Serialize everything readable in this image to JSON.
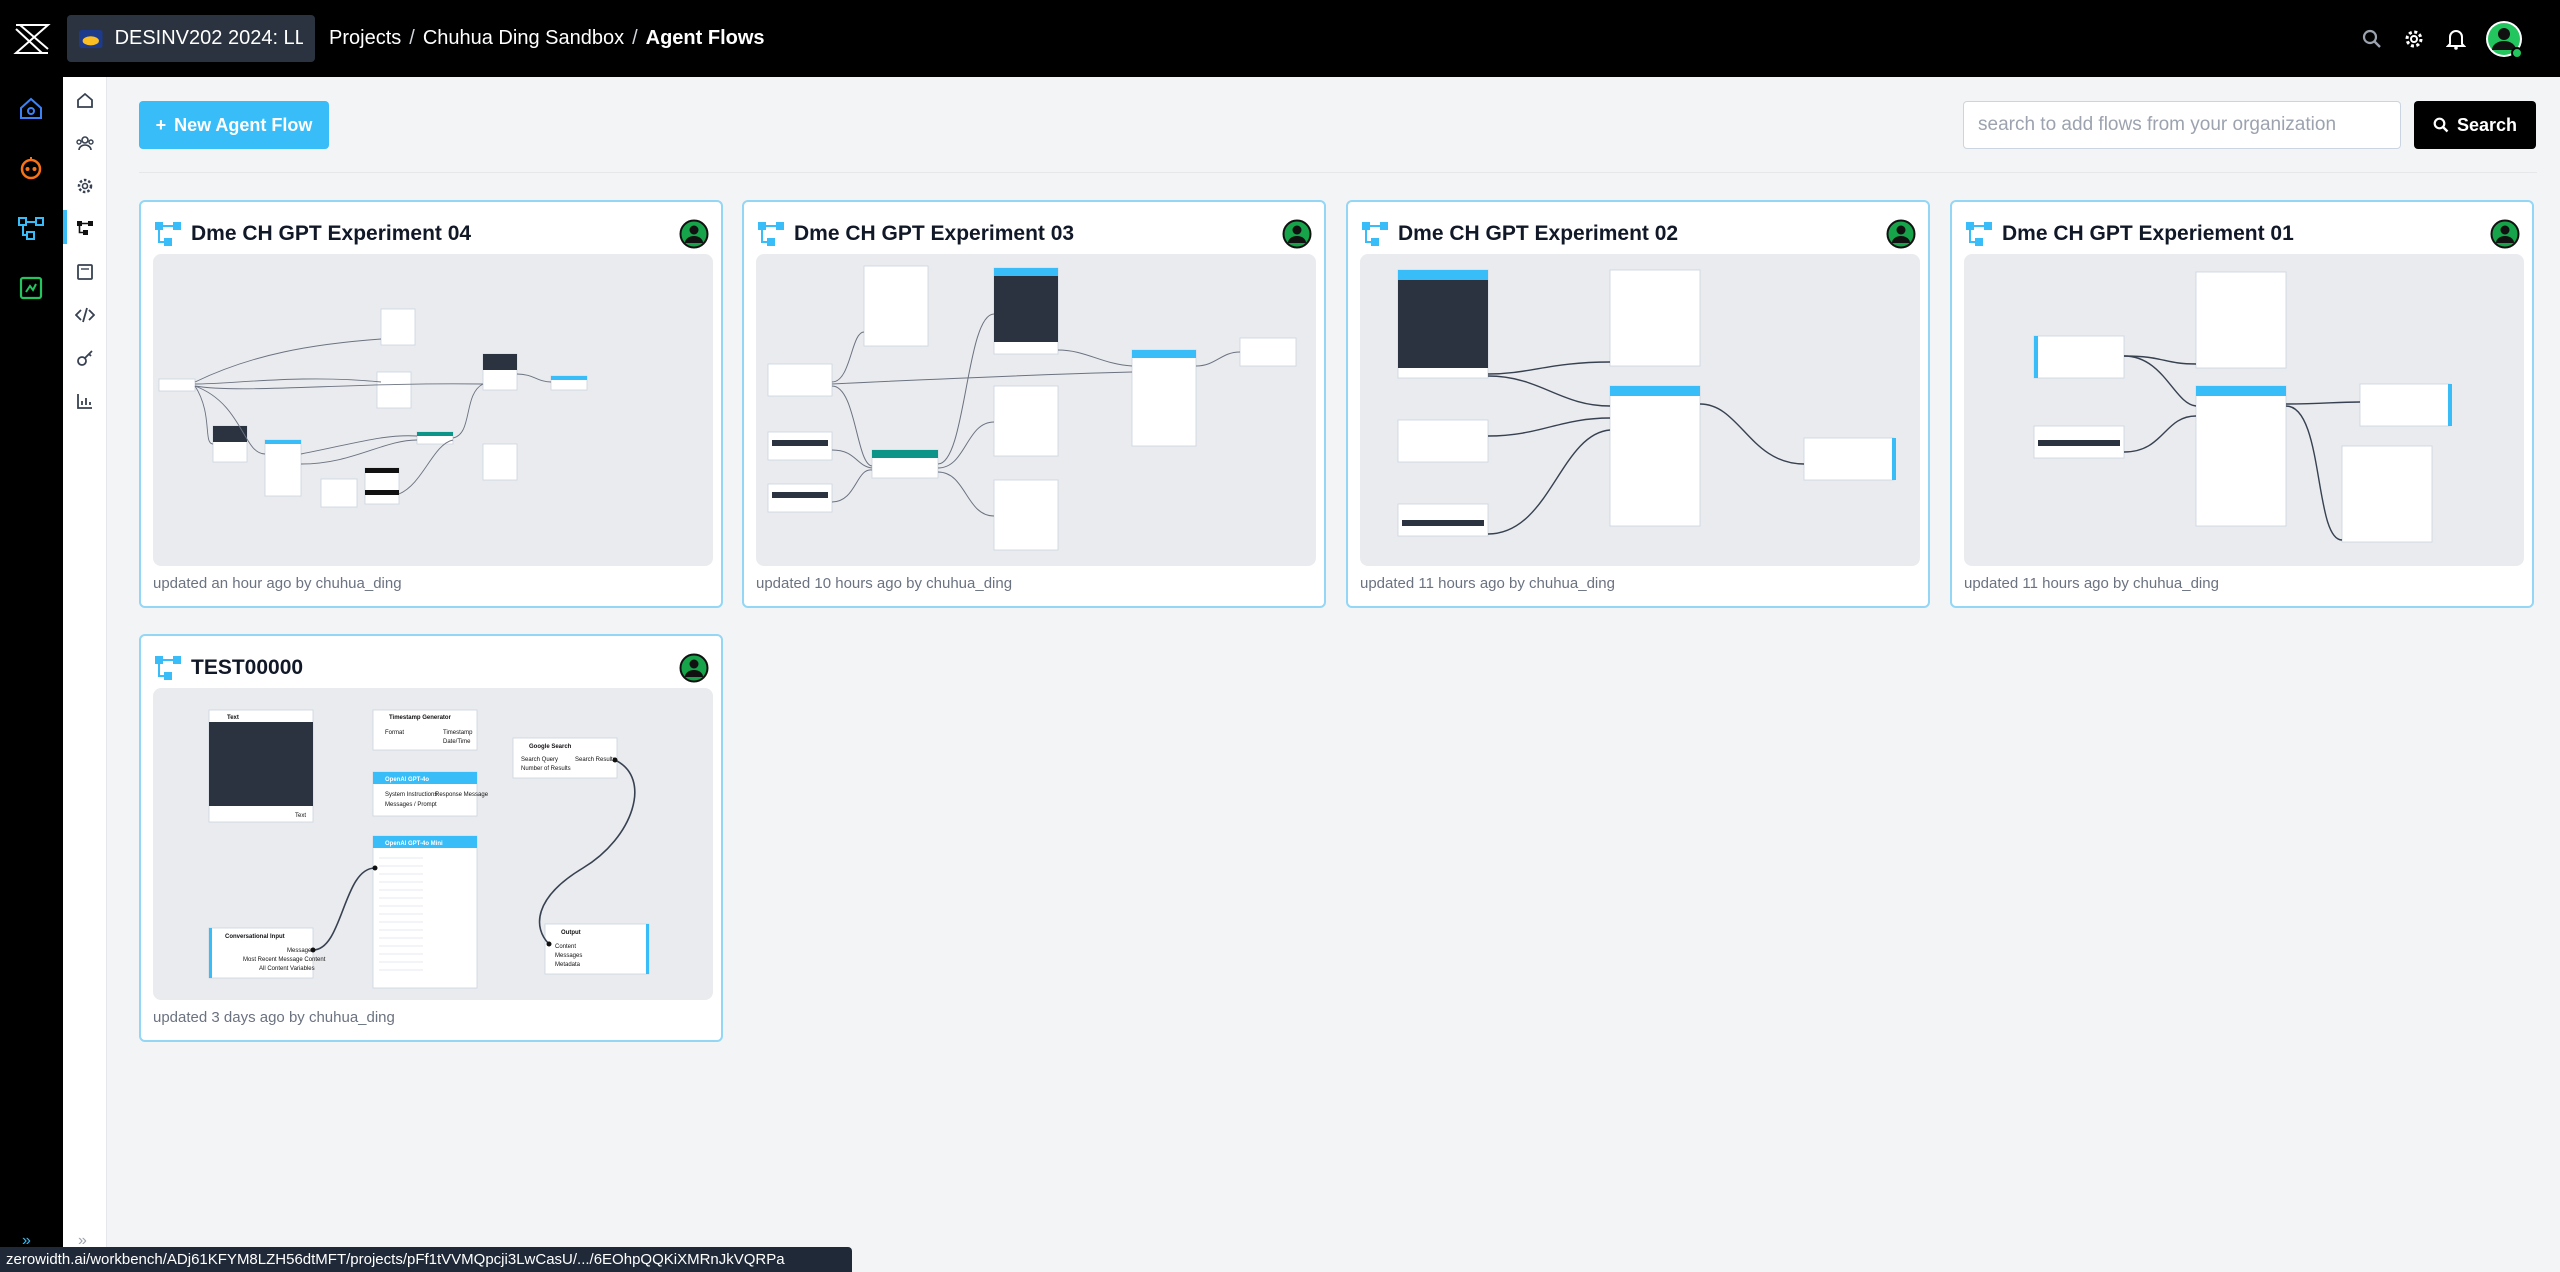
{
  "header": {
    "org_name": "DESINV202 2024: LL...",
    "breadcrumbs": [
      "Projects",
      "Chuhua Ding Sandbox",
      "Agent Flows"
    ],
    "separator": "/",
    "icons": [
      "search-icon",
      "settings-icon",
      "bell-icon",
      "user-avatar"
    ]
  },
  "toolbar": {
    "new_flow_label": "New Agent Flow",
    "search_placeholder": "search to add flows from your organization",
    "search_value": "",
    "search_button_label": "Search"
  },
  "cards": [
    {
      "title": "Dme CH GPT Experiment 04",
      "meta": "updated an hour ago by chuhua_ding"
    },
    {
      "title": "Dme CH GPT Experiment 03",
      "meta": "updated 10 hours ago by chuhua_ding"
    },
    {
      "title": "Dme CH GPT Experiment 02",
      "meta": "updated 11 hours ago by chuhua_ding"
    },
    {
      "title": "Dme CH GPT Experiement 01",
      "meta": "updated 11 hours ago by chuhua_ding"
    },
    {
      "title": "TEST00000",
      "meta": "updated 3 days ago by chuhua_ding"
    }
  ],
  "test_preview": {
    "nodes": {
      "text": "Text",
      "text_port": "Text",
      "timestamp": "Timestamp Generator",
      "timestamp_in": "Format",
      "timestamp_out1": "Timestamp",
      "timestamp_out2": "Date/Time",
      "google": "Google Search",
      "google_in1": "Search Query",
      "google_in2": "Number of Results",
      "google_out": "Search Results",
      "gpt4o": "OpenAI GPT-4o",
      "gpt4o_in1": "System Instructions",
      "gpt4o_in2": "Messages / Prompt",
      "gpt4o_out": "Response Message",
      "gpt4omini": "OpenAI GPT-4o Mini",
      "conv": "Conversational Input",
      "conv_out": "Messages",
      "conv_in1": "Most Recent Message Content",
      "conv_in2": "All Content Variables",
      "output": "Output",
      "output_in1": "Content",
      "output_in2": "Messages",
      "output_in3": "Metadata"
    }
  },
  "status_url": "zerowidth.ai/workbench/ADj61KFYM8LZH56dtMFT/projects/pFf1tVVMQpcji3LwCasU/.../6EOhpQQKiXMRnJkVQRPa",
  "colors": {
    "accent": "#38bdf8",
    "topbar": "#000000",
    "background": "#f3f4f6"
  }
}
